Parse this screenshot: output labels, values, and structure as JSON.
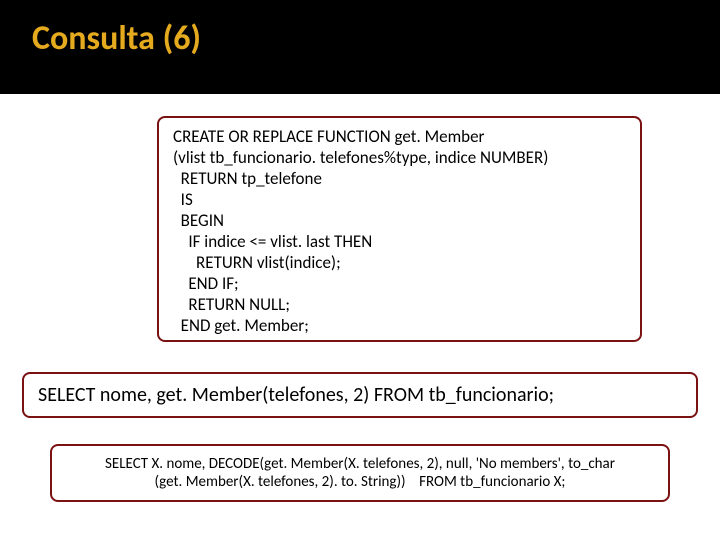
{
  "title": "Consulta (6)",
  "box1": {
    "l0": "CREATE OR REPLACE FUNCTION get. Member",
    "l1": "(vlist tb_funcionario. telefones%type, indice NUMBER)",
    "l2": "  RETURN tp_telefone",
    "l3": "  IS",
    "l4": "  BEGIN",
    "l5": "    IF indice <= vlist. last THEN",
    "l6": "      RETURN vlist(indice);",
    "l7": "    END IF;",
    "l8": "    RETURN NULL;",
    "l9": "  END get. Member;"
  },
  "box2": {
    "l0": "SELECT nome, get. Member(telefones, 2) FROM tb_funcionario;"
  },
  "box3": {
    "l0": "SELECT X. nome, DECODE(get. Member(X. telefones, 2), null, 'No members', to_char",
    "l1": "(get. Member(X. telefones, 2). to. String))    FROM tb_funcionario X;"
  }
}
